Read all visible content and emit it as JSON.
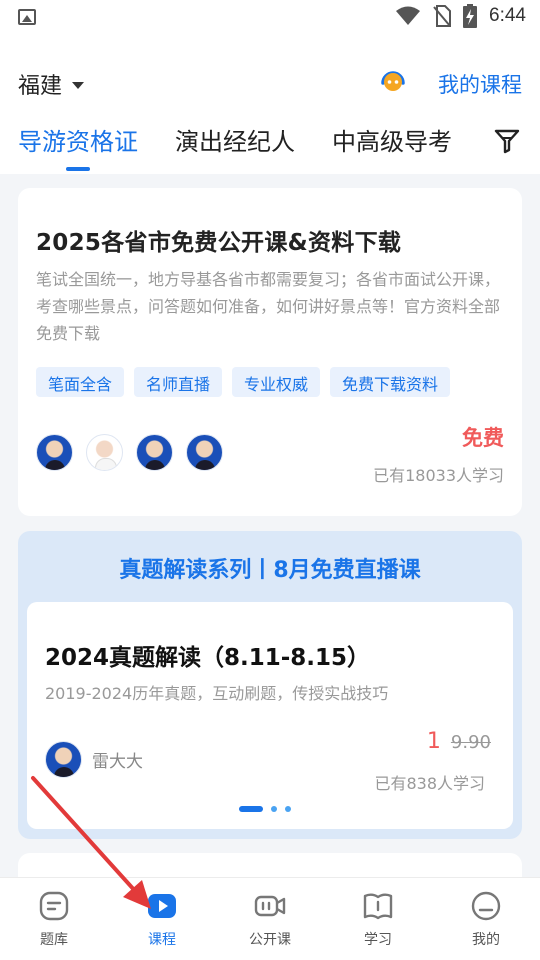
{
  "status_bar": {
    "time": "6:44"
  },
  "header": {
    "region": "福建",
    "my_course": "我的课程",
    "tabs": [
      {
        "label": "导游资格证",
        "active": true
      },
      {
        "label": "演出经纪人",
        "active": false
      },
      {
        "label": "中高级导考",
        "active": false
      }
    ]
  },
  "featured": {
    "title": "2025各省市免费公开课&资料下载",
    "description": "笔试全国统一，地方导基各省市都需要复习；各省市面试公开课，考查哪些景点，问答题如何准备，如何讲好景点等！官方资料全部免费下载",
    "tags": [
      "笔面全含",
      "名师直播",
      "专业权威",
      "免费下载资料"
    ],
    "price_label": "免费",
    "learners": "已有18033人学习"
  },
  "live_series": {
    "title": "真题解读系列丨8月免费直播课",
    "course": {
      "title": "2024真题解读（8.11-8.15）",
      "description": "2019-2024历年真题，互动刷题，传授实战技巧",
      "teacher": "雷大大",
      "price_now": "1",
      "price_old": "9.90",
      "learners": "已有838人学习"
    }
  },
  "bottom_nav": [
    {
      "label": "题库"
    },
    {
      "label": "课程"
    },
    {
      "label": "公开课"
    },
    {
      "label": "学习"
    },
    {
      "label": "我的"
    }
  ],
  "colors": {
    "accent": "#1a74e8",
    "price": "#f05a5a",
    "annotation": "#e23a3a"
  }
}
